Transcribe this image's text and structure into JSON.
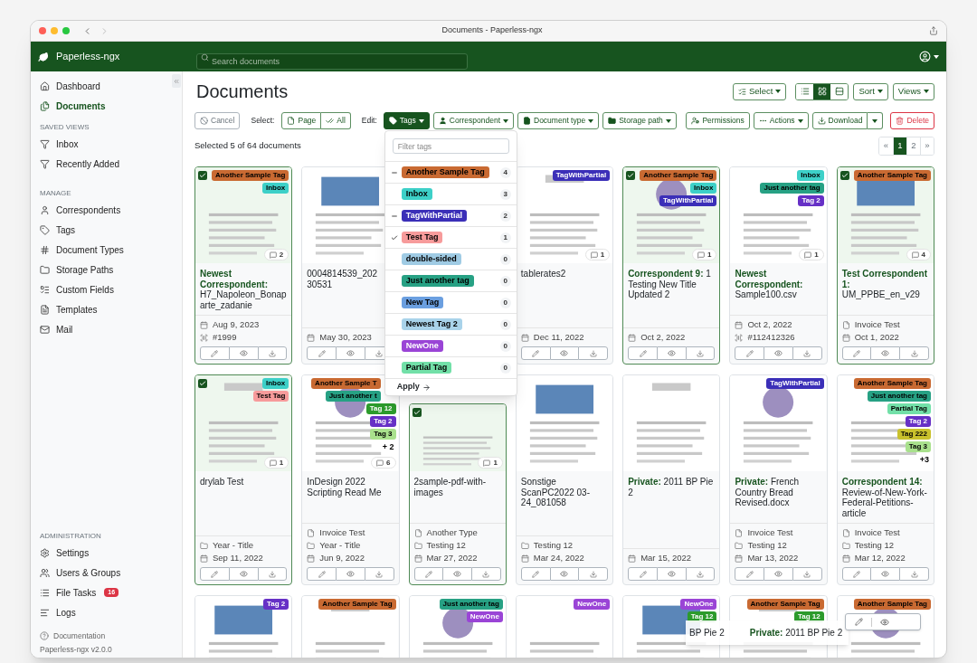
{
  "window": {
    "title": "Documents - Paperless-ngx"
  },
  "header": {
    "app_name": "Paperless-ngx",
    "search": {
      "placeholder": "Search documents"
    }
  },
  "sidebar": {
    "top_items": [
      {
        "label": "Dashboard",
        "selected": false
      },
      {
        "label": "Documents",
        "selected": true
      }
    ],
    "sections": [
      {
        "heading": "SAVED VIEWS",
        "items": [
          {
            "label": "Inbox",
            "selected": false
          },
          {
            "label": "Recently Added",
            "selected": false
          }
        ]
      },
      {
        "heading": "MANAGE",
        "items": [
          {
            "label": "Correspondents",
            "selected": false
          },
          {
            "label": "Tags",
            "selected": false
          },
          {
            "label": "Document Types",
            "selected": false
          },
          {
            "label": "Storage Paths",
            "selected": false
          },
          {
            "label": "Custom Fields",
            "selected": false
          },
          {
            "label": "Templates",
            "selected": false
          },
          {
            "label": "Mail",
            "selected": false
          }
        ]
      }
    ],
    "admin": {
      "heading": "ADMINISTRATION",
      "items": [
        {
          "label": "Settings",
          "selected": false
        },
        {
          "label": "Users & Groups",
          "selected": false
        },
        {
          "label": "File Tasks",
          "badge": "16",
          "selected": false
        },
        {
          "label": "Logs",
          "selected": false
        }
      ]
    },
    "documentation": "Documentation",
    "version": "Paperless-ngx v2.0.0"
  },
  "page": {
    "title": "Documents",
    "select_menu": "Select",
    "view_modes": [
      {
        "selected": false
      },
      {
        "selected": true
      },
      {
        "selected": false
      }
    ],
    "sort": "Sort",
    "views": "Views"
  },
  "toolbar": {
    "cancel": "Cancel",
    "select_label": "Select:",
    "select_buttons": [
      "Page",
      "All"
    ],
    "edit_label": "Edit:",
    "edit_buttons": [
      {
        "label": "Tags",
        "selected": true
      },
      {
        "label": "Correspondent",
        "selected": false
      },
      {
        "label": "Document type",
        "selected": false
      },
      {
        "label": "Storage path",
        "selected": false
      }
    ],
    "permissions": "Permissions",
    "actions": "Actions",
    "download": "Download",
    "delete": "Delete"
  },
  "status": "Selected 5 of 64 documents",
  "pagination": [
    {
      "label": "«",
      "selected": false
    },
    {
      "label": "1",
      "selected": true
    },
    {
      "label": "2",
      "selected": false
    },
    {
      "label": "»",
      "selected": false
    }
  ],
  "tag_menu": {
    "placeholder": "Filter tags",
    "apply": "Apply",
    "items": [
      {
        "name": "Another Sample Tag",
        "color": "#c96a32",
        "count": "4",
        "checked": false,
        "partial": true
      },
      {
        "name": "Inbox",
        "color": "#3dd0c8",
        "count": "3",
        "checked": false,
        "partial": false
      },
      {
        "name": "TagWithPartial",
        "color": "#3b2fb8",
        "count": "2",
        "checked": false,
        "partial": true
      },
      {
        "name": "Test Tag",
        "color": "#f79b9b",
        "count": "1",
        "checked": true,
        "partial": false
      },
      {
        "name": "double-sided",
        "color": "#9fcbe4",
        "count": "0",
        "checked": false,
        "partial": false
      },
      {
        "name": "Just another tag",
        "color": "#27a184",
        "count": "0",
        "checked": false,
        "partial": false
      },
      {
        "name": "New Tag",
        "color": "#6b9fe0",
        "count": "0",
        "checked": false,
        "partial": false
      },
      {
        "name": "Newest Tag 2",
        "color": "#a9d3ea",
        "count": "0",
        "checked": false,
        "partial": false
      },
      {
        "name": "NewOne",
        "color": "#9a44d6",
        "count": "0",
        "checked": false,
        "partial": false
      },
      {
        "name": "Partial Tag",
        "color": "#72e0a8",
        "count": "0",
        "checked": false,
        "partial": false
      }
    ]
  },
  "documents": [
    {
      "selected": true,
      "tags": [
        {
          "name": "Another Sample Tag",
          "color": "#c96a32"
        },
        {
          "name": "Inbox",
          "color": "#3dd0c8"
        }
      ],
      "comments": "2",
      "correspondent": "Newest Correspondent:",
      "title": "H7_Napoleon_Bonaparte_zadanie",
      "meta": [
        {
          "kind": "date",
          "text": "Aug 9, 2023"
        },
        {
          "kind": "asn",
          "text": "#1999"
        }
      ]
    },
    {
      "selected": false,
      "title": "0004814539_20230531",
      "title_cut": true,
      "meta": [
        {
          "kind": "date",
          "text": "May 30, 2023"
        }
      ]
    },
    {
      "selected": false,
      "tags": [
        {
          "name": "TagWithPartial",
          "color": "#3b2fb8"
        }
      ],
      "comments": "1",
      "title": "tablerates2",
      "meta": [
        {
          "kind": "date",
          "text": "Dec 11, 2022"
        }
      ]
    },
    {
      "selected": true,
      "tags": [
        {
          "name": "Another Sample Tag",
          "color": "#c96a32"
        },
        {
          "name": "Inbox",
          "color": "#3dd0c8"
        },
        {
          "name": "TagWithPartial",
          "color": "#3b2fb8"
        }
      ],
      "comments": "1",
      "correspondent": "Correspondent 9:",
      "title": "1 Testing New Title Updated 2",
      "meta": [
        {
          "kind": "date",
          "text": "Oct 2, 2022"
        }
      ]
    },
    {
      "selected": false,
      "tags": [
        {
          "name": "Inbox",
          "color": "#3dd0c8"
        },
        {
          "name": "Just another tag",
          "color": "#27a184"
        },
        {
          "name": "Tag 2",
          "color": "#6630c6"
        }
      ],
      "comments": "1",
      "correspondent": "Newest Correspondent:",
      "title": "Sample100.csv",
      "meta": [
        {
          "kind": "date",
          "text": "Oct 2, 2022"
        },
        {
          "kind": "asn",
          "text": "#112412326"
        }
      ]
    },
    {
      "selected": true,
      "tags": [
        {
          "name": "Another Sample Tag",
          "color": "#c96a32"
        }
      ],
      "comments": "4",
      "correspondent": "Test Correspondent 1:",
      "title": "UM_PPBE_en_v29",
      "meta": [
        {
          "kind": "type",
          "text": "Invoice Test"
        },
        {
          "kind": "date",
          "text": "Oct 1, 2022"
        }
      ]
    },
    {
      "selected": true,
      "tags": [
        {
          "name": "Inbox",
          "color": "#3dd0c8"
        },
        {
          "name": "Test Tag",
          "color": "#f79b9b"
        }
      ],
      "comments": "1",
      "title": "drylab Test",
      "meta": [
        {
          "kind": "path",
          "text": "Year - Title"
        },
        {
          "kind": "date",
          "text": "Sep 11, 2022"
        }
      ]
    },
    {
      "selected": false,
      "tags": [
        {
          "name": "Another Sample T",
          "color": "#c96a32",
          "cut": true
        },
        {
          "name": "Just another t",
          "color": "#27a184",
          "cut": true
        },
        {
          "name": "Tag 12",
          "color": "#2c9b2c"
        },
        {
          "name": "Tag 2",
          "color": "#6630c6"
        },
        {
          "name": "Tag 3",
          "color": "#a9e18d"
        }
      ],
      "more": "+ 2",
      "comments": "6",
      "title": "InDesign 2022 Scripting Read Me",
      "meta": [
        {
          "kind": "type",
          "text": "Invoice Test"
        },
        {
          "kind": "path",
          "text": "Year - Title"
        },
        {
          "kind": "date",
          "text": "Jun 9, 2022"
        }
      ]
    },
    {
      "selected": true,
      "top_covered": true,
      "comments": "1",
      "title": "2sample-pdf-with-images",
      "meta": [
        {
          "kind": "type",
          "text": "Another Type"
        },
        {
          "kind": "path",
          "text": "Testing 12"
        },
        {
          "kind": "date",
          "text": "Mar 27, 2022"
        }
      ]
    },
    {
      "selected": false,
      "title": "Sonstige ScanPC2022 03-24_081058",
      "meta": [
        {
          "kind": "path",
          "text": "Testing 12"
        },
        {
          "kind": "date",
          "text": "Mar 24, 2022"
        }
      ]
    },
    {
      "selected": false,
      "correspondent": "Private:",
      "title": "2011 BP Pie 2",
      "meta": [
        {
          "kind": "date",
          "text": "Mar 15, 2022"
        }
      ]
    },
    {
      "selected": false,
      "tags": [
        {
          "name": "TagWithPartial",
          "color": "#3b2fb8"
        }
      ],
      "correspondent": "Private:",
      "title": "French Country Bread Revised.docx",
      "meta": [
        {
          "kind": "type",
          "text": "Invoice Test"
        },
        {
          "kind": "path",
          "text": "Testing 12"
        },
        {
          "kind": "date",
          "text": "Mar 13, 2022"
        }
      ]
    },
    {
      "selected": false,
      "tags": [
        {
          "name": "Another Sample Tag",
          "color": "#c96a32"
        },
        {
          "name": "Just another tag",
          "color": "#27a184"
        },
        {
          "name": "Partial Tag",
          "color": "#72e0a8"
        },
        {
          "name": "Tag 2",
          "color": "#6630c6"
        },
        {
          "name": "Tag 222",
          "color": "#c9c12c"
        },
        {
          "name": "Tag 3",
          "color": "#a9e18d"
        }
      ],
      "more": "+3",
      "correspondent": "Correspondent 14:",
      "title": "Review-of-New-York-Federal-Petitions-article",
      "meta": [
        {
          "kind": "type",
          "text": "Invoice Test"
        },
        {
          "kind": "path",
          "text": "Testing 12"
        },
        {
          "kind": "date",
          "text": "Mar 12, 2022"
        }
      ]
    },
    {
      "selected": false,
      "tags": [
        {
          "name": "Tag 2",
          "color": "#6630c6"
        }
      ]
    },
    {
      "selected": false,
      "tags": [
        {
          "name": "Another Sample Tag",
          "color": "#c96a32"
        }
      ]
    },
    {
      "selected": false,
      "tags": [
        {
          "name": "Just another tag",
          "color": "#27a184"
        },
        {
          "name": "NewOne",
          "color": "#9a44d6"
        }
      ]
    },
    {
      "selected": false,
      "tags": [
        {
          "name": "NewOne",
          "color": "#9a44d6"
        }
      ]
    },
    {
      "selected": false,
      "tags": [
        {
          "name": "NewOne",
          "color": "#9a44d6"
        },
        {
          "name": "Tag 12",
          "color": "#2c9b2c"
        }
      ]
    },
    {
      "selected": false,
      "tags": [
        {
          "name": "Another Sample Tag",
          "color": "#c96a32"
        },
        {
          "name": "Tag 12",
          "color": "#2c9b2c"
        }
      ]
    },
    {
      "selected": false,
      "tags": [
        {
          "name": "Another Sample Tag",
          "color": "#c96a32"
        }
      ]
    }
  ],
  "drag_preview": {
    "title_fragment": "BP Pie 2",
    "correspondent": "Private:",
    "title": "2011 BP Pie 2"
  }
}
